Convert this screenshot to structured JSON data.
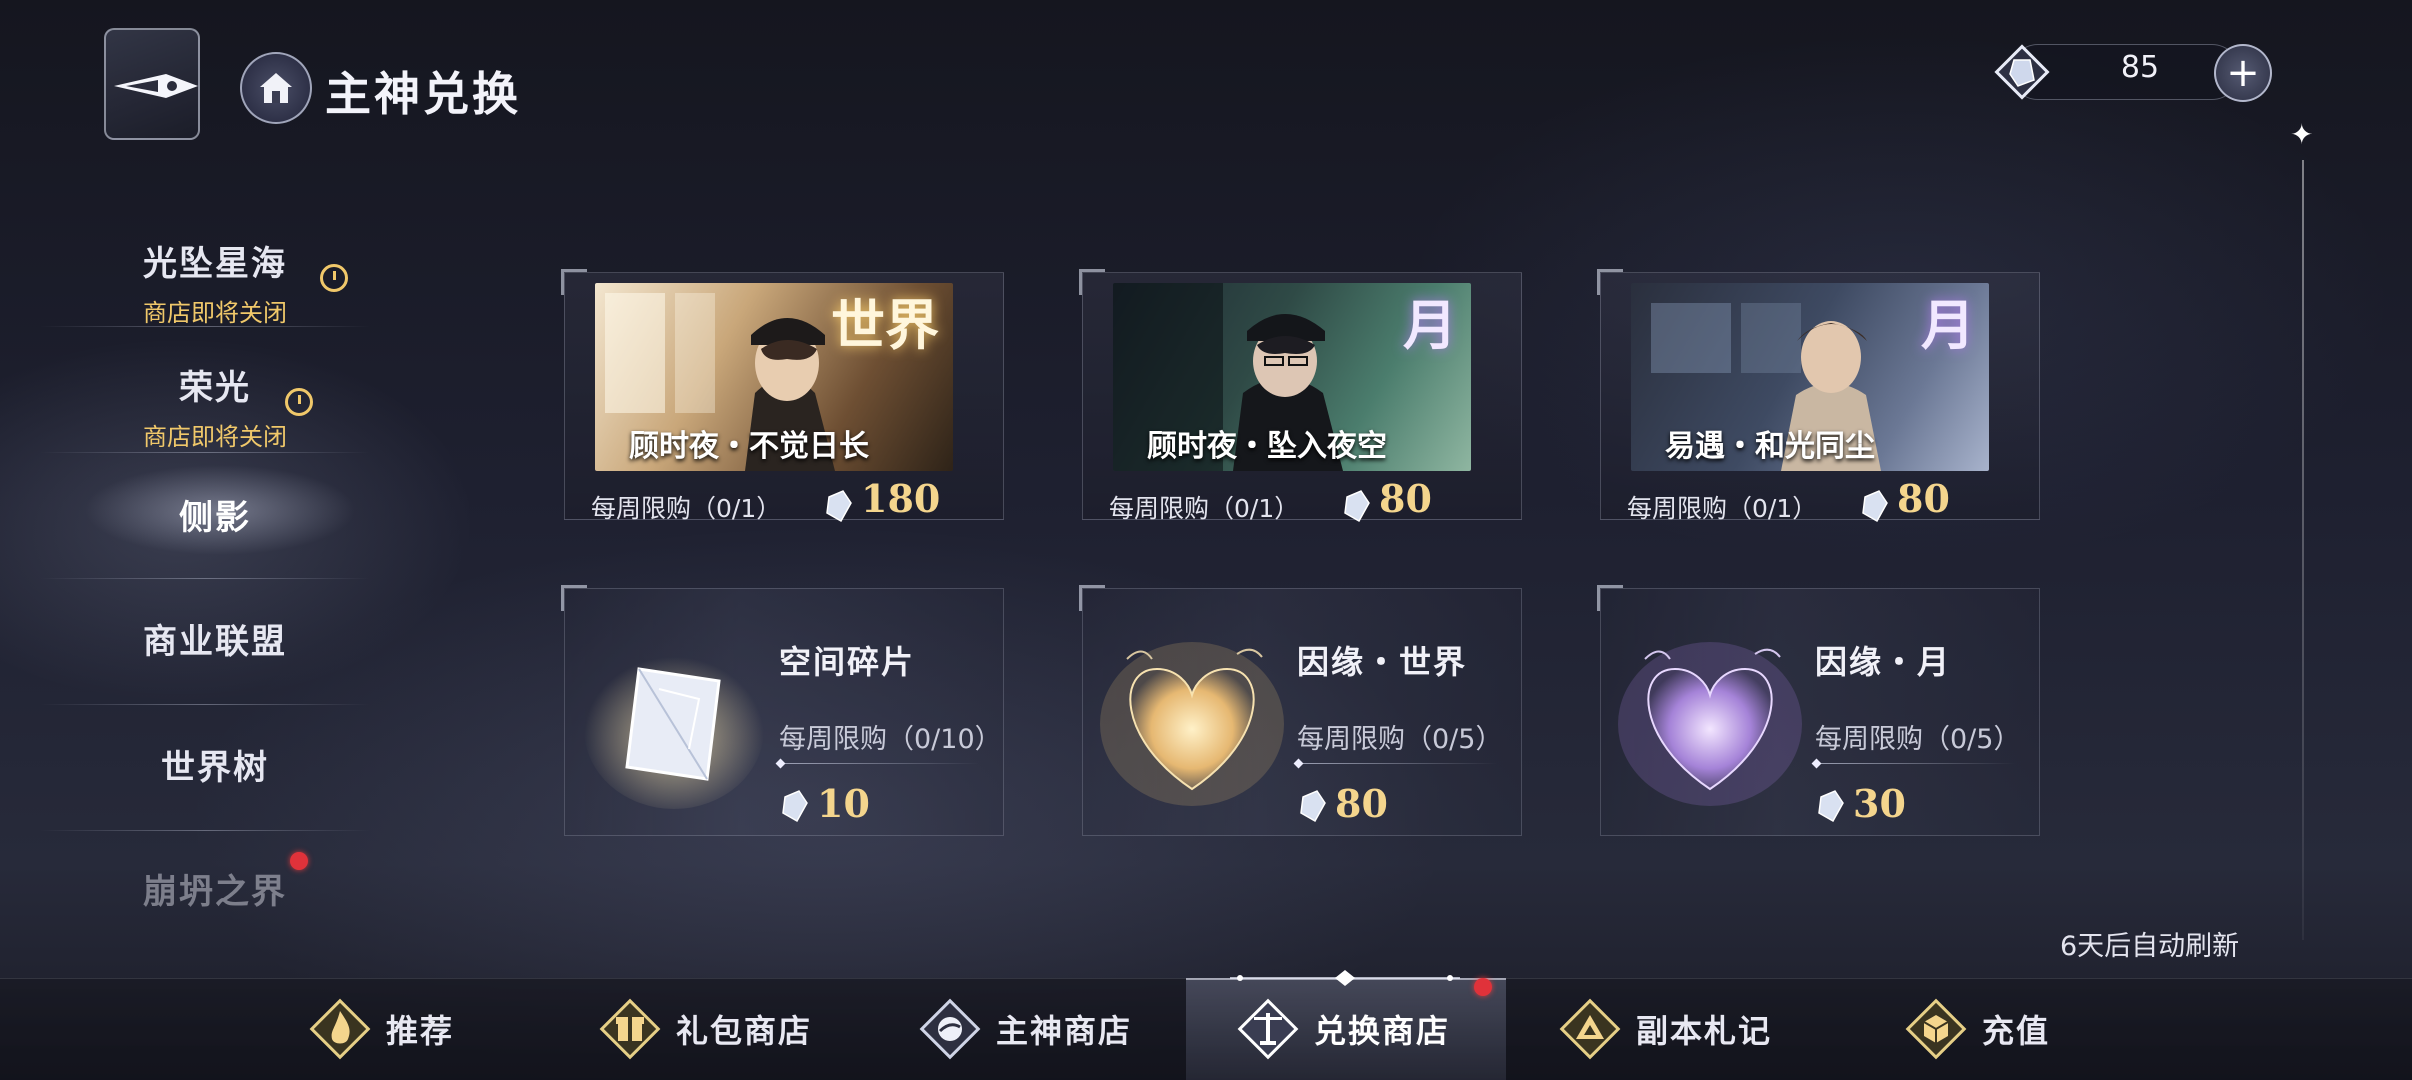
{
  "header": {
    "title": "主神兑换"
  },
  "currency": {
    "amount": "85",
    "add_label": "+"
  },
  "sidebar": {
    "items": [
      {
        "label": "光坠星海",
        "sub": "商店即将关闭",
        "timed": true
      },
      {
        "label": "荣光",
        "sub": "商店即将关闭",
        "timed": true
      },
      {
        "label": "侧影",
        "sub": "",
        "active": true
      },
      {
        "label": "商业联盟",
        "sub": ""
      },
      {
        "label": "世界树",
        "sub": ""
      },
      {
        "label": "崩坍之界",
        "sub": "",
        "badge": true
      }
    ]
  },
  "cards": [
    {
      "title": "顾时夜・不觉日长",
      "tag": "世界",
      "limit": "每周限购（0/1）",
      "price": "180"
    },
    {
      "title": "顾时夜・坠入夜空",
      "tag": "月",
      "limit": "每周限购（0/1）",
      "price": "80"
    },
    {
      "title": "易遇・和光同尘",
      "tag": "月",
      "limit": "每周限购（0/1）",
      "price": "80"
    }
  ],
  "items": [
    {
      "name": "空间碎片",
      "limit": "每周限购（0/10）",
      "price": "10",
      "icon": "crystal-shard-icon"
    },
    {
      "name": "因缘・世界",
      "limit": "每周限购（0/5）",
      "price": "80",
      "icon": "gold-heart-icon"
    },
    {
      "name": "因缘・月",
      "limit": "每周限购（0/5）",
      "price": "30",
      "icon": "purple-heart-icon"
    }
  ],
  "refresh_text": "6天后自动刷新",
  "bottom_nav": [
    {
      "label": "推荐",
      "icon": "flame-icon"
    },
    {
      "label": "礼包商店",
      "icon": "gift-icon"
    },
    {
      "label": "主神商店",
      "icon": "orb-icon"
    },
    {
      "label": "兑换商店",
      "icon": "scale-icon",
      "active": true
    },
    {
      "label": "副本札记",
      "icon": "triangle-icon"
    },
    {
      "label": "充值",
      "icon": "cube-icon"
    }
  ],
  "colors": {
    "price_gold": "#f4d58d",
    "timer_gold": "#f0c86a",
    "badge_red": "#e0323a"
  }
}
